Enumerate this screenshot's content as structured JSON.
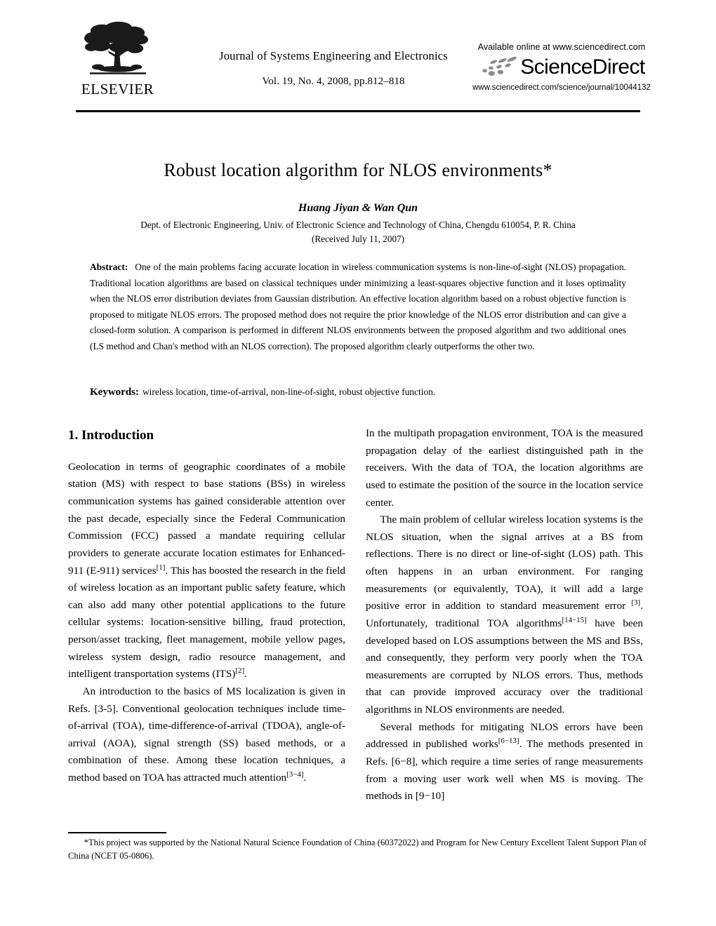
{
  "masthead": {
    "publisher": "ELSEVIER",
    "publisher_logo_icon": "elsevier-tree-logo",
    "journal_title": "Journal of Systems Engineering and Electronics",
    "journal_issue": "Vol. 19, No. 4, 2008, pp.812–818",
    "sciencedirect": {
      "available_line": "Available online at www.sciencedirect.com",
      "wordmark": "ScienceDirect",
      "swoosh_icon": "sciencedirect-swoosh-icon",
      "url_line": "www.sciencedirect.com/science/journal/10044132"
    }
  },
  "article": {
    "title": "Robust location algorithm for NLOS environments*",
    "authors": "Huang Jiyan & Wan Qun",
    "affiliation": "Dept. of Electronic Engineering, Univ. of Electronic Science and Technology of China, Chengdu 610054, P. R. China",
    "received": "(Received July 11, 2007)"
  },
  "abstract": {
    "label": "Abstract:",
    "text": "One of the main problems facing accurate location in wireless communication systems is non-line-of-sight (NLOS) propagation. Traditional location algorithms are based on classical techniques under minimizing a least-squares objective function and it loses optimality when the NLOS error distribution deviates from Gaussian distribution. An effective location algorithm based on a robust objective function is proposed to mitigate NLOS errors. The proposed method does not require the prior knowledge of the NLOS error distribution and can give a closed-form solution. A comparison is performed in different NLOS environments between the proposed algorithm and two additional ones (LS method and Chan's method with an NLOS correction). The proposed algorithm clearly outperforms the other two."
  },
  "keywords": {
    "label": "Keywords:",
    "text": "wireless location, time-of-arrival, non-line-of-sight, robust objective function."
  },
  "columns": {
    "left": {
      "section_heading": "1. Introduction",
      "paragraph_1_part1": "Geolocation in terms of geographic coordinates of a mobile station (MS) with respect to base stations (BSs) in wireless communication systems has gained considerable attention over the past decade, especially since the Federal Communication Commission (FCC) passed a mandate requiring cellular providers to generate accurate location estimates for Enhanced-911 (E-911) services",
      "paragraph_1_sup1": "[1]",
      "paragraph_1_part2": ". This has boosted the research in the field of wireless location as an important public safety feature, which can also add many other potential applications to the future cellular systems: location-sensitive billing, fraud protection, person/asset tracking, fleet management, mobile yellow pages, wireless system design, radio resource management, and intelligent transportation systems (ITS)",
      "paragraph_1_sup2": "[2]",
      "paragraph_1_part3": ".",
      "paragraph_2_part1": "An introduction to the basics of MS localization is given in Refs. [3-5]. Conventional geolocation techniques include time-of-arrival (TOA), time-difference-of-arrival (TDOA), angle-of-arrival (AOA), signal strength (SS) based methods, or a combination of these. Among these location techniques, a method based on TOA has attracted much attention",
      "paragraph_2_sup1": "[3−4]",
      "paragraph_2_part2": "."
    },
    "right": {
      "paragraph_1": "In the multipath propagation environment, TOA is the measured propagation delay of the earliest distinguished path in the receivers. With the data of TOA, the location algorithms are used to estimate the position of the source in the location service center.",
      "paragraph_2_part1": "The main problem of cellular wireless location systems is the NLOS situation, when the signal arrives at a BS from reflections. There is no direct or line-of-sight (LOS) path. This often happens in an urban environment. For ranging measurements (or equivalently, TOA), it will add a large positive error in addition to standard measurement error ",
      "paragraph_2_sup1": "[3]",
      "paragraph_2_part2": ". Unfortunately, traditional TOA algorithms",
      "paragraph_2_sup2": "[14−15]",
      "paragraph_2_part3": " have been developed based on LOS assumptions between the MS and BSs, and consequently, they perform very poorly when the TOA measurements are corrupted by NLOS errors. Thus, methods that can provide improved accuracy over the traditional algorithms in NLOS environments are needed.",
      "paragraph_3_part1": "Several methods for mitigating NLOS errors have been addressed in published works",
      "paragraph_3_sup1": "[6−13]",
      "paragraph_3_part2": ". The methods presented in Refs. [6−8], which require a time series of range measurements from a moving user work well when MS is moving. The methods in [9−10]"
    }
  },
  "footnote": {
    "text": "*This project was supported by the National Natural Science Foundation of China (60372022) and Program for New Century Excellent Talent Support Plan of China (NCET 05-0806)."
  }
}
